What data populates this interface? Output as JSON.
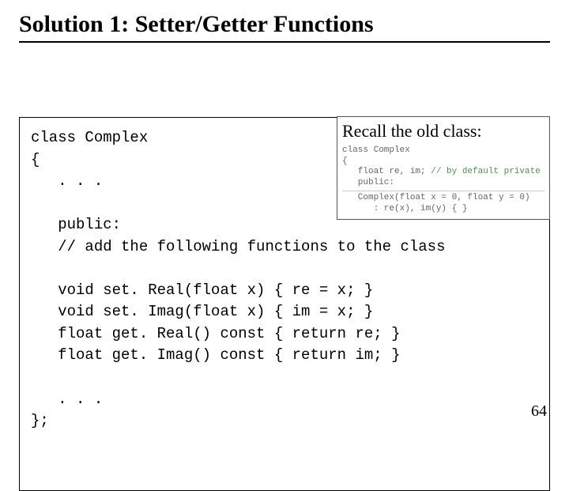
{
  "title": "Solution 1: Setter/Getter Functions",
  "page_number": "64",
  "code": {
    "l1": "class Complex",
    "l2": "{",
    "l3": "   . . .",
    "l4": "",
    "l5": "   public:",
    "l6": "   // add the following functions to the class",
    "l7": "",
    "l8": "   void set. Real(float x) { re = x; }",
    "l9": "   void set. Imag(float x) { im = x; }",
    "l10": "   float get. Real() const { return re; }",
    "l11": "   float get. Imag() const { return im; }",
    "l12": "",
    "l13": "   . . .",
    "l14": "};"
  },
  "recall": {
    "title": "Recall the old class:",
    "r1": "class Complex",
    "r2": "{",
    "r3_a": "   float re, im; ",
    "r3_b": "// by default private",
    "r4": "   public:",
    "r5": "   Complex(float x = 0, float y = 0)",
    "r6": "      : re(x), im(y) { }"
  }
}
